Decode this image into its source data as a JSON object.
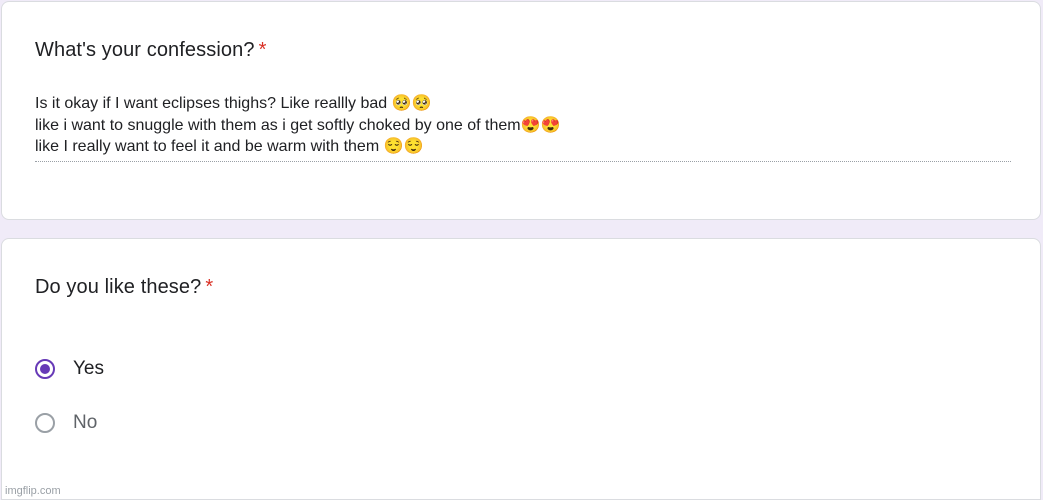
{
  "questions": [
    {
      "title": "What's your confession?",
      "required_mark": "*",
      "answer_lines": [
        "Is it okay if I want eclipses thighs? Like reallly bad 🥺🥺",
        "like i want to snuggle with them as i get softly choked by one of them😍😍",
        "like I really want to feel it and be warm with them 😌😌"
      ]
    },
    {
      "title": "Do you like these?",
      "required_mark": "*",
      "options": [
        {
          "label": "Yes",
          "selected": true
        },
        {
          "label": "No",
          "selected": false
        }
      ]
    }
  ],
  "watermark": "imgflip.com",
  "colors": {
    "background": "#f0ebf8",
    "accent": "#673ab7",
    "required": "#d93025",
    "card_border": "#dadce0"
  }
}
